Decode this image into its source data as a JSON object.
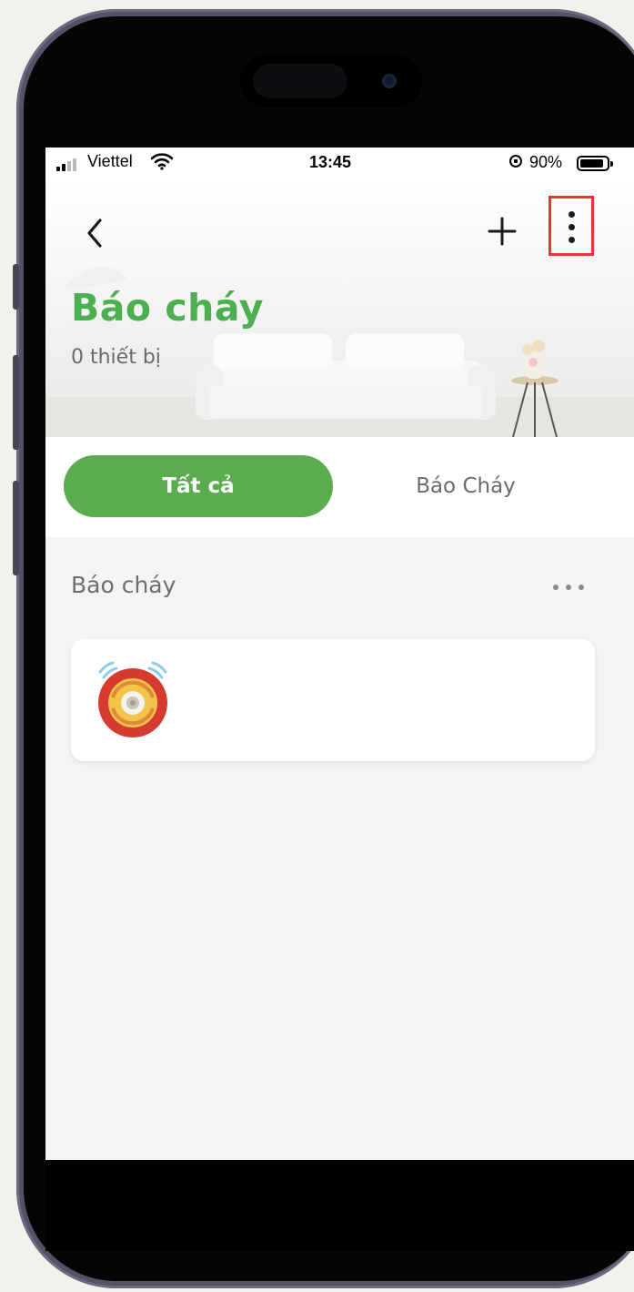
{
  "status_bar": {
    "carrier": "Viettel",
    "time": "13:45",
    "battery_percent": "90%",
    "battery_level": 0.9
  },
  "header": {
    "back_icon": "chevron-left-icon",
    "add_icon": "plus-icon",
    "more_icon": "vertical-ellipsis-icon",
    "title": "Báo cháy",
    "subtitle": "0 thiết bị",
    "accent_color": "#4caf50",
    "highlight_color": "#e8332f"
  },
  "tabs": [
    {
      "label": "Tất cả",
      "active": true
    },
    {
      "label": "Báo Cháy",
      "active": false
    }
  ],
  "section": {
    "title": "Báo cháy",
    "more_icon": "horizontal-ellipsis-icon"
  },
  "devices": [
    {
      "icon": "smoke-alarm-icon",
      "name": ""
    }
  ]
}
